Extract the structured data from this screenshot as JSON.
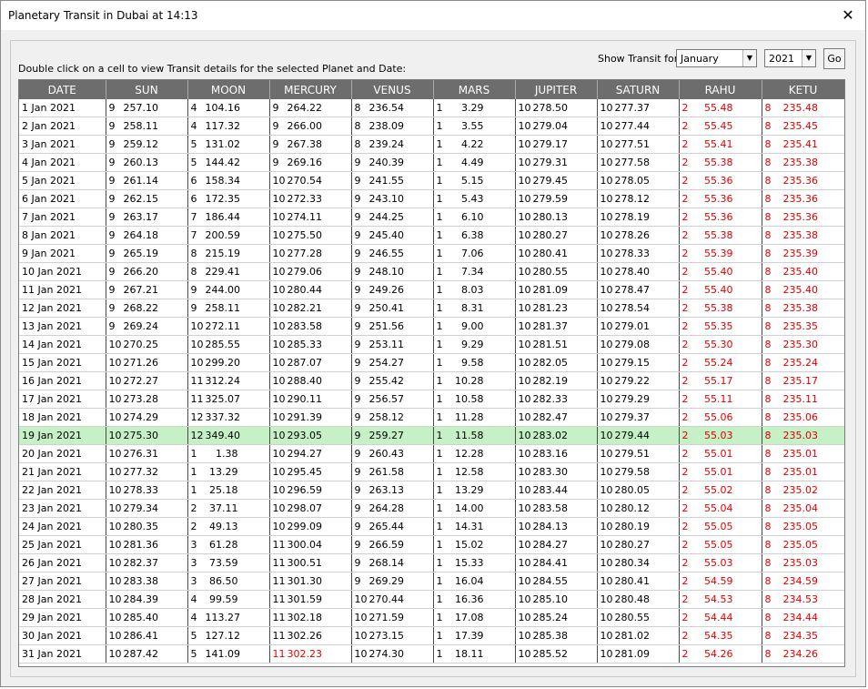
{
  "window": {
    "title": "Planetary Transit in Dubai at 14:13",
    "close_glyph": "✕"
  },
  "hint": "Double click on a cell to view Transit details for the selected Planet and Date:",
  "controls": {
    "show_label": "Show Transit for:",
    "month": "January",
    "year": "2021",
    "go_label": "Go"
  },
  "columns": [
    "DATE",
    "SUN",
    "MOON",
    "MERCURY",
    "VENUS",
    "MARS",
    "JUPITER",
    "SATURN",
    "RAHU",
    "KETU"
  ],
  "colors": {
    "retrograde": "#e00000",
    "selected_row": "#c6f0c6",
    "header_bg": "#6d6d6d"
  },
  "selected_row_index": 18,
  "rows": [
    {
      "date": "1 Jan 2021",
      "c": [
        [
          "9",
          "257.10"
        ],
        [
          "4",
          "104.16"
        ],
        [
          "9",
          "264.22"
        ],
        [
          "8",
          "236.54"
        ],
        [
          "1",
          "3.29"
        ],
        [
          "10",
          "278.50"
        ],
        [
          "10",
          "277.37"
        ],
        [
          "2",
          "55.48"
        ],
        [
          "8",
          "235.48"
        ]
      ]
    },
    {
      "date": "2 Jan 2021",
      "c": [
        [
          "9",
          "258.11"
        ],
        [
          "4",
          "117.32"
        ],
        [
          "9",
          "266.00"
        ],
        [
          "8",
          "238.09"
        ],
        [
          "1",
          "3.55"
        ],
        [
          "10",
          "279.04"
        ],
        [
          "10",
          "277.44"
        ],
        [
          "2",
          "55.45"
        ],
        [
          "8",
          "235.45"
        ]
      ]
    },
    {
      "date": "3 Jan 2021",
      "c": [
        [
          "9",
          "259.12"
        ],
        [
          "5",
          "131.02"
        ],
        [
          "9",
          "267.38"
        ],
        [
          "8",
          "239.24"
        ],
        [
          "1",
          "4.22"
        ],
        [
          "10",
          "279.17"
        ],
        [
          "10",
          "277.51"
        ],
        [
          "2",
          "55.41"
        ],
        [
          "8",
          "235.41"
        ]
      ]
    },
    {
      "date": "4 Jan 2021",
      "c": [
        [
          "9",
          "260.13"
        ],
        [
          "5",
          "144.42"
        ],
        [
          "9",
          "269.16"
        ],
        [
          "9",
          "240.39"
        ],
        [
          "1",
          "4.49"
        ],
        [
          "10",
          "279.31"
        ],
        [
          "10",
          "277.58"
        ],
        [
          "2",
          "55.38"
        ],
        [
          "8",
          "235.38"
        ]
      ]
    },
    {
      "date": "5 Jan 2021",
      "c": [
        [
          "9",
          "261.14"
        ],
        [
          "6",
          "158.34"
        ],
        [
          "10",
          "270.54"
        ],
        [
          "9",
          "241.55"
        ],
        [
          "1",
          "5.15"
        ],
        [
          "10",
          "279.45"
        ],
        [
          "10",
          "278.05"
        ],
        [
          "2",
          "55.36"
        ],
        [
          "8",
          "235.36"
        ]
      ]
    },
    {
      "date": "6 Jan 2021",
      "c": [
        [
          "9",
          "262.15"
        ],
        [
          "6",
          "172.35"
        ],
        [
          "10",
          "272.33"
        ],
        [
          "9",
          "243.10"
        ],
        [
          "1",
          "5.43"
        ],
        [
          "10",
          "279.59"
        ],
        [
          "10",
          "278.12"
        ],
        [
          "2",
          "55.36"
        ],
        [
          "8",
          "235.36"
        ]
      ]
    },
    {
      "date": "7 Jan 2021",
      "c": [
        [
          "9",
          "263.17"
        ],
        [
          "7",
          "186.44"
        ],
        [
          "10",
          "274.11"
        ],
        [
          "9",
          "244.25"
        ],
        [
          "1",
          "6.10"
        ],
        [
          "10",
          "280.13"
        ],
        [
          "10",
          "278.19"
        ],
        [
          "2",
          "55.36"
        ],
        [
          "8",
          "235.36"
        ]
      ]
    },
    {
      "date": "8 Jan 2021",
      "c": [
        [
          "9",
          "264.18"
        ],
        [
          "7",
          "200.59"
        ],
        [
          "10",
          "275.50"
        ],
        [
          "9",
          "245.40"
        ],
        [
          "1",
          "6.38"
        ],
        [
          "10",
          "280.27"
        ],
        [
          "10",
          "278.26"
        ],
        [
          "2",
          "55.38"
        ],
        [
          "8",
          "235.38"
        ]
      ]
    },
    {
      "date": "9 Jan 2021",
      "c": [
        [
          "9",
          "265.19"
        ],
        [
          "8",
          "215.19"
        ],
        [
          "10",
          "277.28"
        ],
        [
          "9",
          "246.55"
        ],
        [
          "1",
          "7.06"
        ],
        [
          "10",
          "280.41"
        ],
        [
          "10",
          "278.33"
        ],
        [
          "2",
          "55.39"
        ],
        [
          "8",
          "235.39"
        ]
      ]
    },
    {
      "date": "10 Jan 2021",
      "c": [
        [
          "9",
          "266.20"
        ],
        [
          "8",
          "229.41"
        ],
        [
          "10",
          "279.06"
        ],
        [
          "9",
          "248.10"
        ],
        [
          "1",
          "7.34"
        ],
        [
          "10",
          "280.55"
        ],
        [
          "10",
          "278.40"
        ],
        [
          "2",
          "55.40"
        ],
        [
          "8",
          "235.40"
        ]
      ]
    },
    {
      "date": "11 Jan 2021",
      "c": [
        [
          "9",
          "267.21"
        ],
        [
          "9",
          "244.00"
        ],
        [
          "10",
          "280.44"
        ],
        [
          "9",
          "249.26"
        ],
        [
          "1",
          "8.03"
        ],
        [
          "10",
          "281.09"
        ],
        [
          "10",
          "278.47"
        ],
        [
          "2",
          "55.40"
        ],
        [
          "8",
          "235.40"
        ]
      ]
    },
    {
      "date": "12 Jan 2021",
      "c": [
        [
          "9",
          "268.22"
        ],
        [
          "9",
          "258.11"
        ],
        [
          "10",
          "282.21"
        ],
        [
          "9",
          "250.41"
        ],
        [
          "1",
          "8.31"
        ],
        [
          "10",
          "281.23"
        ],
        [
          "10",
          "278.54"
        ],
        [
          "2",
          "55.38"
        ],
        [
          "8",
          "235.38"
        ]
      ]
    },
    {
      "date": "13 Jan 2021",
      "c": [
        [
          "9",
          "269.24"
        ],
        [
          "10",
          "272.11"
        ],
        [
          "10",
          "283.58"
        ],
        [
          "9",
          "251.56"
        ],
        [
          "1",
          "9.00"
        ],
        [
          "10",
          "281.37"
        ],
        [
          "10",
          "279.01"
        ],
        [
          "2",
          "55.35"
        ],
        [
          "8",
          "235.35"
        ]
      ]
    },
    {
      "date": "14 Jan 2021",
      "c": [
        [
          "10",
          "270.25"
        ],
        [
          "10",
          "285.55"
        ],
        [
          "10",
          "285.33"
        ],
        [
          "9",
          "253.11"
        ],
        [
          "1",
          "9.29"
        ],
        [
          "10",
          "281.51"
        ],
        [
          "10",
          "279.08"
        ],
        [
          "2",
          "55.30"
        ],
        [
          "8",
          "235.30"
        ]
      ]
    },
    {
      "date": "15 Jan 2021",
      "c": [
        [
          "10",
          "271.26"
        ],
        [
          "10",
          "299.20"
        ],
        [
          "10",
          "287.07"
        ],
        [
          "9",
          "254.27"
        ],
        [
          "1",
          "9.58"
        ],
        [
          "10",
          "282.05"
        ],
        [
          "10",
          "279.15"
        ],
        [
          "2",
          "55.24"
        ],
        [
          "8",
          "235.24"
        ]
      ]
    },
    {
      "date": "16 Jan 2021",
      "c": [
        [
          "10",
          "272.27"
        ],
        [
          "11",
          "312.24"
        ],
        [
          "10",
          "288.40"
        ],
        [
          "9",
          "255.42"
        ],
        [
          "1",
          "10.28"
        ],
        [
          "10",
          "282.19"
        ],
        [
          "10",
          "279.22"
        ],
        [
          "2",
          "55.17"
        ],
        [
          "8",
          "235.17"
        ]
      ]
    },
    {
      "date": "17 Jan 2021",
      "c": [
        [
          "10",
          "273.28"
        ],
        [
          "11",
          "325.07"
        ],
        [
          "10",
          "290.11"
        ],
        [
          "9",
          "256.57"
        ],
        [
          "1",
          "10.58"
        ],
        [
          "10",
          "282.33"
        ],
        [
          "10",
          "279.29"
        ],
        [
          "2",
          "55.11"
        ],
        [
          "8",
          "235.11"
        ]
      ]
    },
    {
      "date": "18 Jan 2021",
      "c": [
        [
          "10",
          "274.29"
        ],
        [
          "12",
          "337.32"
        ],
        [
          "10",
          "291.39"
        ],
        [
          "9",
          "258.12"
        ],
        [
          "1",
          "11.28"
        ],
        [
          "10",
          "282.47"
        ],
        [
          "10",
          "279.37"
        ],
        [
          "2",
          "55.06"
        ],
        [
          "8",
          "235.06"
        ]
      ]
    },
    {
      "date": "19 Jan 2021",
      "c": [
        [
          "10",
          "275.30"
        ],
        [
          "12",
          "349.40"
        ],
        [
          "10",
          "293.05"
        ],
        [
          "9",
          "259.27"
        ],
        [
          "1",
          "11.58"
        ],
        [
          "10",
          "283.02"
        ],
        [
          "10",
          "279.44"
        ],
        [
          "2",
          "55.03"
        ],
        [
          "8",
          "235.03"
        ]
      ]
    },
    {
      "date": "20 Jan 2021",
      "c": [
        [
          "10",
          "276.31"
        ],
        [
          "1",
          "1.38"
        ],
        [
          "10",
          "294.27"
        ],
        [
          "9",
          "260.43"
        ],
        [
          "1",
          "12.28"
        ],
        [
          "10",
          "283.16"
        ],
        [
          "10",
          "279.51"
        ],
        [
          "2",
          "55.01"
        ],
        [
          "8",
          "235.01"
        ]
      ]
    },
    {
      "date": "21 Jan 2021",
      "c": [
        [
          "10",
          "277.32"
        ],
        [
          "1",
          "13.29"
        ],
        [
          "10",
          "295.45"
        ],
        [
          "9",
          "261.58"
        ],
        [
          "1",
          "12.58"
        ],
        [
          "10",
          "283.30"
        ],
        [
          "10",
          "279.58"
        ],
        [
          "2",
          "55.01"
        ],
        [
          "8",
          "235.01"
        ]
      ]
    },
    {
      "date": "22 Jan 2021",
      "c": [
        [
          "10",
          "278.33"
        ],
        [
          "1",
          "25.18"
        ],
        [
          "10",
          "296.59"
        ],
        [
          "9",
          "263.13"
        ],
        [
          "1",
          "13.29"
        ],
        [
          "10",
          "283.44"
        ],
        [
          "10",
          "280.05"
        ],
        [
          "2",
          "55.02"
        ],
        [
          "8",
          "235.02"
        ]
      ]
    },
    {
      "date": "23 Jan 2021",
      "c": [
        [
          "10",
          "279.34"
        ],
        [
          "2",
          "37.11"
        ],
        [
          "10",
          "298.07"
        ],
        [
          "9",
          "264.28"
        ],
        [
          "1",
          "14.00"
        ],
        [
          "10",
          "283.58"
        ],
        [
          "10",
          "280.12"
        ],
        [
          "2",
          "55.04"
        ],
        [
          "8",
          "235.04"
        ]
      ]
    },
    {
      "date": "24 Jan 2021",
      "c": [
        [
          "10",
          "280.35"
        ],
        [
          "2",
          "49.13"
        ],
        [
          "10",
          "299.09"
        ],
        [
          "9",
          "265.44"
        ],
        [
          "1",
          "14.31"
        ],
        [
          "10",
          "284.13"
        ],
        [
          "10",
          "280.19"
        ],
        [
          "2",
          "55.05"
        ],
        [
          "8",
          "235.05"
        ]
      ]
    },
    {
      "date": "25 Jan 2021",
      "c": [
        [
          "10",
          "281.36"
        ],
        [
          "3",
          "61.28"
        ],
        [
          "11",
          "300.04"
        ],
        [
          "9",
          "266.59"
        ],
        [
          "1",
          "15.02"
        ],
        [
          "10",
          "284.27"
        ],
        [
          "10",
          "280.27"
        ],
        [
          "2",
          "55.05"
        ],
        [
          "8",
          "235.05"
        ]
      ]
    },
    {
      "date": "26 Jan 2021",
      "c": [
        [
          "10",
          "282.37"
        ],
        [
          "3",
          "73.59"
        ],
        [
          "11",
          "300.51"
        ],
        [
          "9",
          "268.14"
        ],
        [
          "1",
          "15.33"
        ],
        [
          "10",
          "284.41"
        ],
        [
          "10",
          "280.34"
        ],
        [
          "2",
          "55.03"
        ],
        [
          "8",
          "235.03"
        ]
      ]
    },
    {
      "date": "27 Jan 2021",
      "c": [
        [
          "10",
          "283.38"
        ],
        [
          "3",
          "86.50"
        ],
        [
          "11",
          "301.30"
        ],
        [
          "9",
          "269.29"
        ],
        [
          "1",
          "16.04"
        ],
        [
          "10",
          "284.55"
        ],
        [
          "10",
          "280.41"
        ],
        [
          "2",
          "54.59"
        ],
        [
          "8",
          "234.59"
        ]
      ]
    },
    {
      "date": "28 Jan 2021",
      "c": [
        [
          "10",
          "284.39"
        ],
        [
          "4",
          "99.59"
        ],
        [
          "11",
          "301.59"
        ],
        [
          "10",
          "270.44"
        ],
        [
          "1",
          "16.36"
        ],
        [
          "10",
          "285.10"
        ],
        [
          "10",
          "280.48"
        ],
        [
          "2",
          "54.53"
        ],
        [
          "8",
          "234.53"
        ]
      ]
    },
    {
      "date": "29 Jan 2021",
      "c": [
        [
          "10",
          "285.40"
        ],
        [
          "4",
          "113.27"
        ],
        [
          "11",
          "302.18"
        ],
        [
          "10",
          "271.59"
        ],
        [
          "1",
          "17.08"
        ],
        [
          "10",
          "285.24"
        ],
        [
          "10",
          "280.55"
        ],
        [
          "2",
          "54.44"
        ],
        [
          "8",
          "234.44"
        ]
      ]
    },
    {
      "date": "30 Jan 2021",
      "c": [
        [
          "10",
          "286.41"
        ],
        [
          "5",
          "127.12"
        ],
        [
          "11",
          "302.26"
        ],
        [
          "10",
          "273.15"
        ],
        [
          "1",
          "17.39"
        ],
        [
          "10",
          "285.38"
        ],
        [
          "10",
          "281.02"
        ],
        [
          "2",
          "54.35"
        ],
        [
          "8",
          "234.35"
        ]
      ]
    },
    {
      "date": "31 Jan 2021",
      "c": [
        [
          "10",
          "287.42"
        ],
        [
          "5",
          "141.09"
        ],
        [
          "11",
          "302.23",
          "r"
        ],
        [
          "10",
          "274.30"
        ],
        [
          "1",
          "18.11"
        ],
        [
          "10",
          "285.52"
        ],
        [
          "10",
          "281.09"
        ],
        [
          "2",
          "54.26"
        ],
        [
          "8",
          "234.26"
        ]
      ]
    }
  ]
}
